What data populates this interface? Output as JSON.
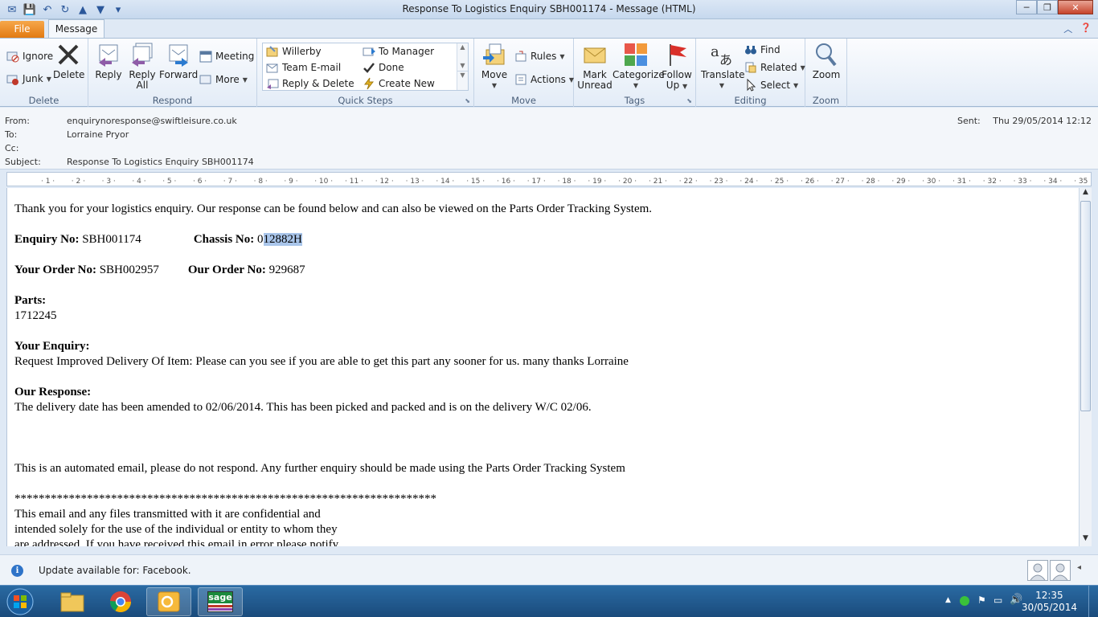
{
  "window": {
    "title": "Response To Logistics Enquiry SBH001174  -  Message (HTML)"
  },
  "tabs": {
    "file": "File",
    "message": "Message"
  },
  "ribbon": {
    "delete_group": {
      "label": "Delete",
      "ignore": "Ignore",
      "junk": "Junk",
      "delete": "Delete"
    },
    "respond_group": {
      "label": "Respond",
      "reply": "Reply",
      "reply_all_1": "Reply",
      "reply_all_2": "All",
      "forward": "Forward",
      "meeting": "Meeting",
      "more": "More"
    },
    "quicksteps_group": {
      "label": "Quick Steps",
      "items": [
        "Willerby",
        "To Manager",
        "Team E-mail",
        "Done",
        "Reply & Delete",
        "Create New"
      ]
    },
    "move_group": {
      "label": "Move",
      "move": "Move",
      "rules": "Rules",
      "actions": "Actions"
    },
    "tags_group": {
      "label": "Tags",
      "mark_unread_1": "Mark",
      "mark_unread_2": "Unread",
      "categorize": "Categorize",
      "follow_up_1": "Follow",
      "follow_up_2": "Up"
    },
    "editing_group": {
      "label": "Editing",
      "translate": "Translate",
      "find": "Find",
      "related": "Related",
      "select": "Select"
    },
    "zoom_group": {
      "label": "Zoom",
      "zoom": "Zoom"
    }
  },
  "header": {
    "from_label": "From:",
    "from": "enquirynoresponse@swiftleisure.co.uk",
    "to_label": "To:",
    "to": "Lorraine Pryor",
    "cc_label": "Cc:",
    "cc": "",
    "subject_label": "Subject:",
    "subject": "Response To Logistics Enquiry SBH001174",
    "sent_label": "Sent:",
    "sent": "Thu 29/05/2014 12:12"
  },
  "body": {
    "intro": "Thank you for your logistics enquiry. Our response can be found below and can also be viewed on the Parts Order Tracking System.",
    "enquiry_no_label": "Enquiry No:",
    "enquiry_no": "SBH001174",
    "chassis_no_label": "Chassis No:",
    "chassis_no_prefix": "0",
    "chassis_no_selected": "12882H",
    "your_order_label": "Your Order No:",
    "your_order": "SBH002957",
    "our_order_label": "Our Order No:",
    "our_order": "929687",
    "parts_label": "Parts:",
    "parts": "1712245",
    "your_enquiry_label": "Your Enquiry:",
    "your_enquiry": "Request Improved Delivery Of Item: Please can you see if you are able to get this part any sooner for us. many thanks Lorraine",
    "our_response_label": "Our Response:",
    "our_response": "The delivery date has been amended to 02/06/2014. This has been picked and packed and is on the delivery W/C 02/06.",
    "automated": "This is an automated email, please do not respond. Any further enquiry should be made using the Parts Order Tracking System",
    "stars": "**********************************************************************",
    "disclaimer_1": "This email and any files transmitted with it are confidential and",
    "disclaimer_2": "intended solely for the use of the individual or entity to whom they",
    "disclaimer_3": "are addressed. If you have received this email in error please notify"
  },
  "infobar": {
    "text": "Update available for: Facebook."
  },
  "taskbar": {
    "time": "12:35",
    "date": "30/05/2014",
    "sage_label": "sage"
  }
}
